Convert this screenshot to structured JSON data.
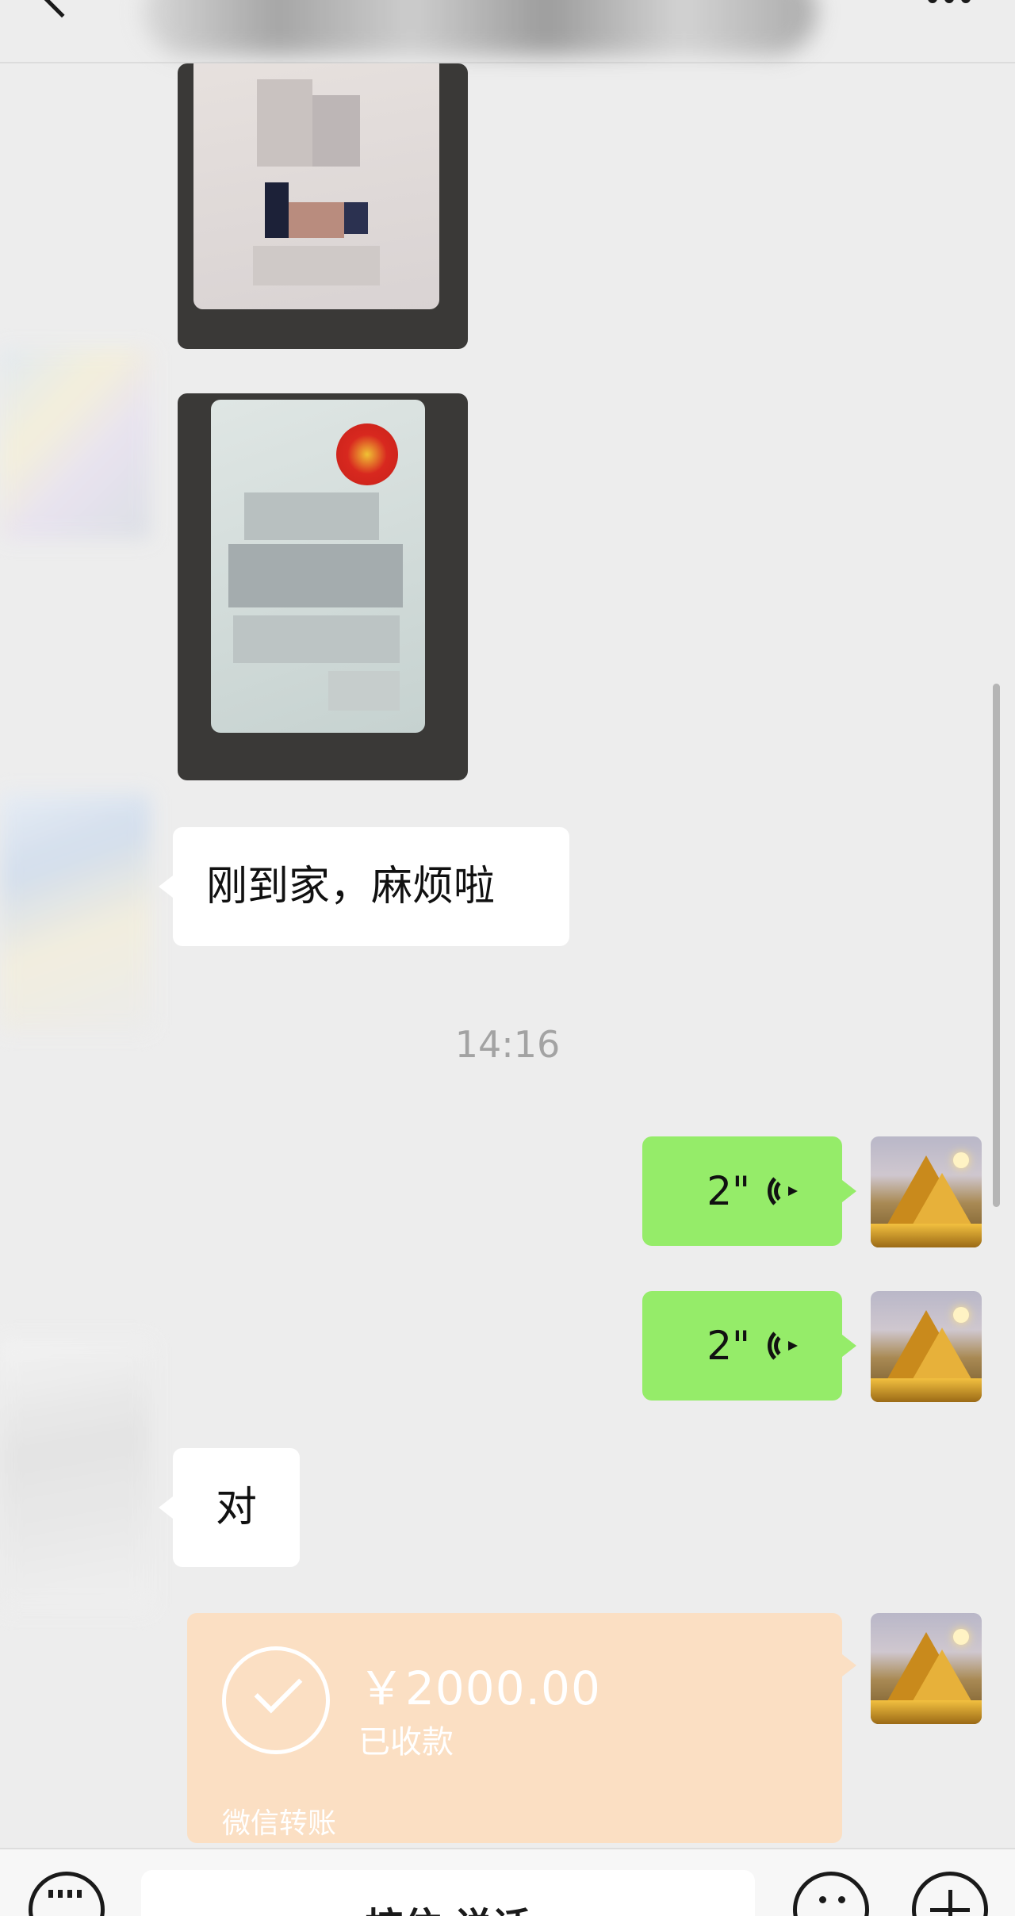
{
  "header": {
    "title": "",
    "back_icon": "chevron-left-icon",
    "more_icon": "more-dots-icon"
  },
  "messages": {
    "incoming_text_1": "刚到家，麻烦啦",
    "timestamp": "14:16",
    "voice_1_duration": "2\"",
    "voice_2_duration": "2\"",
    "incoming_text_2": "对"
  },
  "transfer": {
    "amount": "￥2000.00",
    "status": "已收款",
    "label": "微信转账"
  },
  "input_bar": {
    "hold_to_talk": "按住 说话",
    "keyboard_icon": "keyboard-icon",
    "emoji_icon": "emoji-icon",
    "plus_icon": "plus-icon"
  },
  "colors": {
    "background": "#ededed",
    "outgoing_bubble": "#95ec69",
    "incoming_bubble": "#ffffff",
    "transfer_card": "#fbdfc3",
    "timestamp": "#a3a3a3"
  }
}
